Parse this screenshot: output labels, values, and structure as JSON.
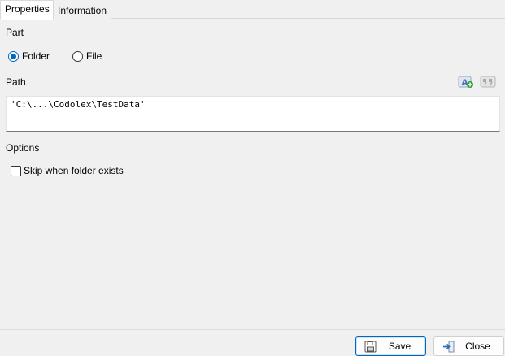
{
  "tabs": [
    {
      "label": "Properties",
      "active": true
    },
    {
      "label": "Information",
      "active": false
    }
  ],
  "part": {
    "label": "Part",
    "options": [
      {
        "label": "Folder",
        "checked": true
      },
      {
        "label": "File",
        "checked": false
      }
    ]
  },
  "path": {
    "label": "Path",
    "value": "'C:\\...\\Codolex\\TestData'",
    "icons": [
      "add-expression-icon",
      "quote-string-icon"
    ]
  },
  "options": {
    "label": "Options",
    "skip_label": "Skip when folder exists",
    "skip_checked": false
  },
  "footer": {
    "save_label": "Save",
    "close_label": "Close"
  },
  "colors": {
    "accent": "#0067c0",
    "background": "#f0f0f0",
    "add_icon_green": "#2e9e3e"
  }
}
